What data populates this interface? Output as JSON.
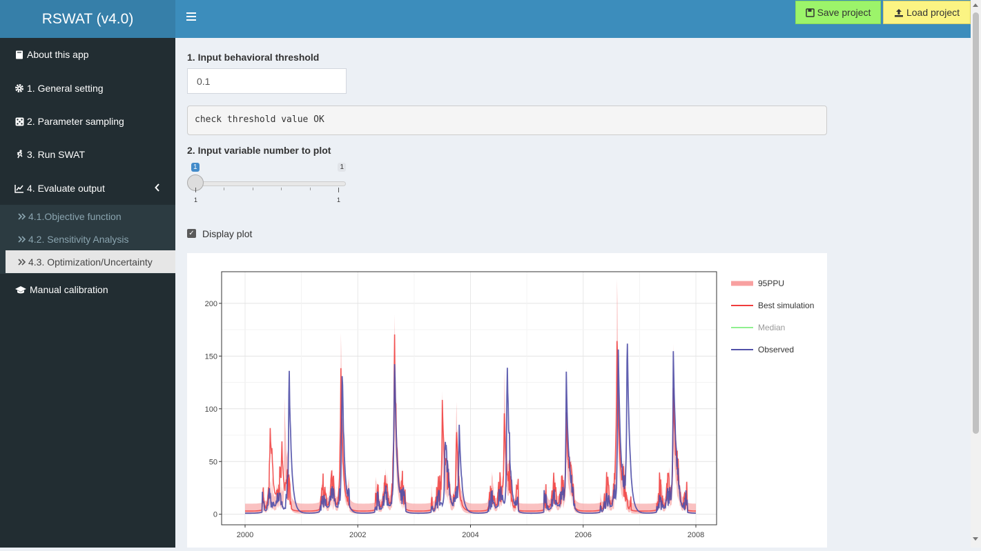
{
  "app": {
    "title": "RSWAT (v4.0)"
  },
  "header": {
    "save_label": "Save project",
    "load_label": "Load project"
  },
  "sidebar": {
    "items": [
      {
        "label": "About this app",
        "icon": "book-icon"
      },
      {
        "label": "1. General setting",
        "icon": "gear-icon"
      },
      {
        "label": "2. Parameter sampling",
        "icon": "dice-icon"
      },
      {
        "label": "3. Run SWAT",
        "icon": "running-icon"
      },
      {
        "label": "4. Evaluate output",
        "icon": "line-chart-icon"
      },
      {
        "label": "Manual calibration",
        "icon": "graduation-cap-icon"
      }
    ],
    "subitems": [
      {
        "label": "4.1.Objective function"
      },
      {
        "label": "4.2. Sensitivity Analysis"
      },
      {
        "label": "4.3. Optimization/Uncertainty",
        "active": true
      }
    ]
  },
  "main": {
    "threshold_label": "1. Input behavioral threshold",
    "threshold_value": "0.1",
    "threshold_message": "check threshold value OK",
    "varnum_label": "2. Input variable number to plot",
    "slider": {
      "min": "1",
      "max": "1",
      "value": "1",
      "tick_min": "1",
      "tick_max": "1"
    },
    "display_plot_label": "Display plot",
    "display_plot_checked": true
  },
  "chart_data": {
    "type": "line",
    "x_range": [
      2000,
      2008
    ],
    "y_range": [
      -10,
      230
    ],
    "x_ticks": [
      "2000",
      "2002",
      "2004",
      "2006",
      "2008"
    ],
    "y_ticks": [
      "0",
      "50",
      "100",
      "150",
      "200"
    ],
    "grid": true,
    "legend_placement": "right",
    "series": [
      {
        "name": "95PPU",
        "color": "#f8a0a0",
        "peaks": [
          [
            2000.7,
            95
          ],
          [
            2001.7,
            150
          ],
          [
            2002.65,
            165
          ],
          [
            2003.5,
            100
          ],
          [
            2003.75,
            80
          ],
          [
            2004.6,
            120
          ],
          [
            2005.7,
            125
          ],
          [
            2006.6,
            200
          ],
          [
            2007.6,
            145
          ]
        ]
      },
      {
        "name": "Best simulation",
        "color": "#f03c3c",
        "peaks": [
          [
            2000.45,
            60
          ],
          [
            2000.65,
            55
          ],
          [
            2001.7,
            100
          ],
          [
            2002.65,
            145
          ],
          [
            2003.5,
            98
          ],
          [
            2003.75,
            55
          ],
          [
            2004.6,
            85
          ],
          [
            2005.7,
            90
          ],
          [
            2006.6,
            150
          ],
          [
            2007.6,
            110
          ]
        ]
      },
      {
        "name": "Median",
        "color": "#8ff08f",
        "peaks": []
      },
      {
        "name": "Observed",
        "color": "#5050a8",
        "peaks": [
          [
            2000.78,
            130
          ],
          [
            2001.72,
            130
          ],
          [
            2002.65,
            135
          ],
          [
            2003.55,
            65
          ],
          [
            2003.8,
            82
          ],
          [
            2004.65,
            133
          ],
          [
            2005.7,
            130
          ],
          [
            2006.62,
            158
          ],
          [
            2006.78,
            169
          ],
          [
            2007.6,
            147
          ]
        ]
      }
    ]
  }
}
